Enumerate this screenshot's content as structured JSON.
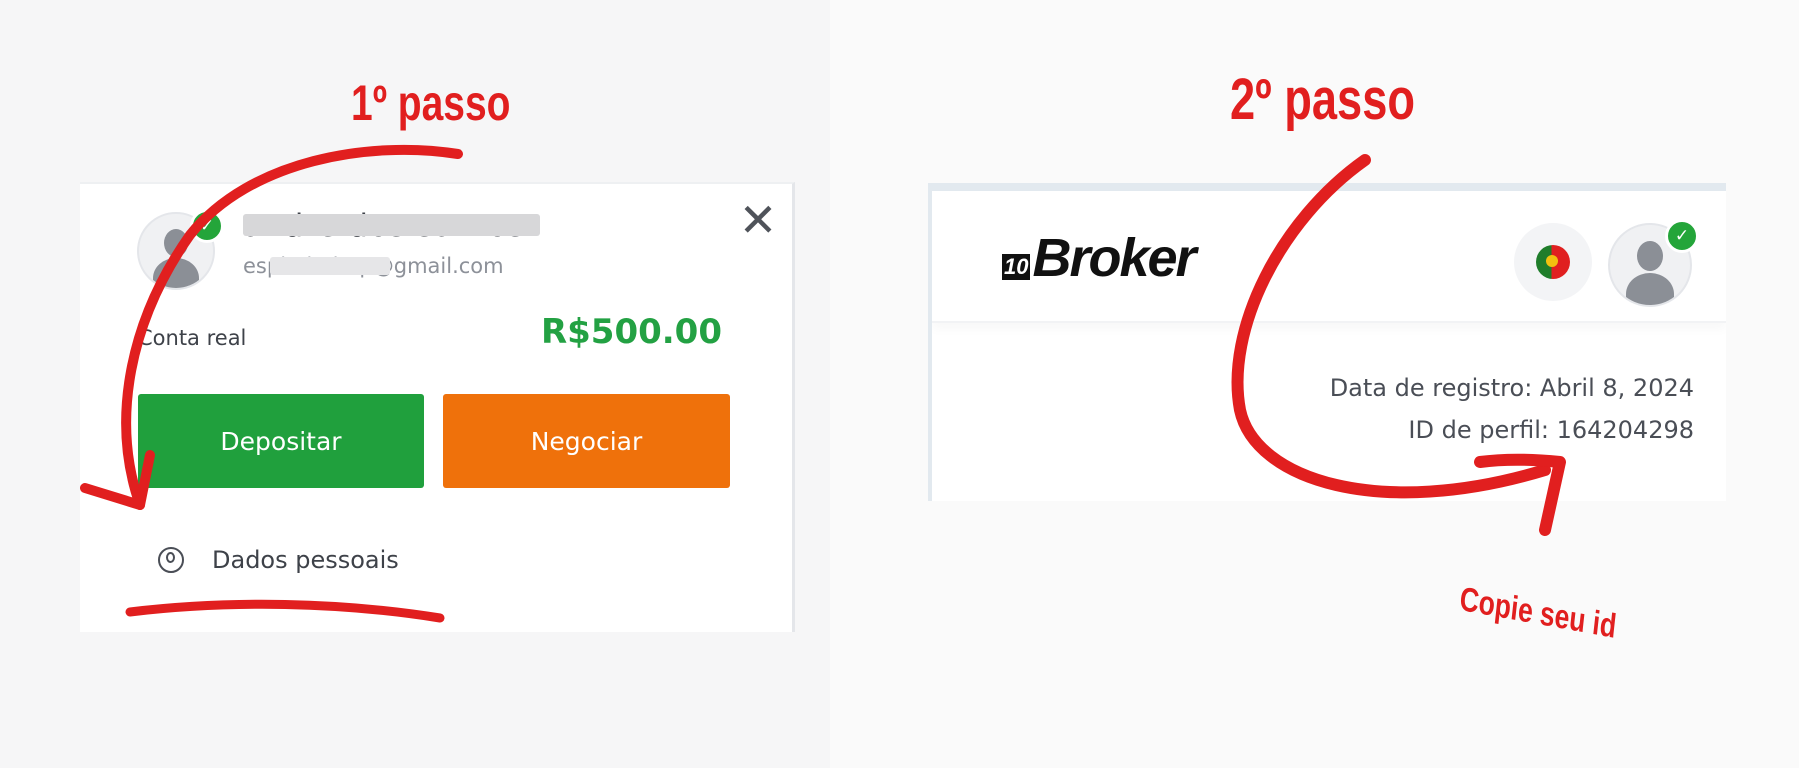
{
  "step1": {
    "label": "1º passo"
  },
  "step2": {
    "label": "2º passo"
  },
  "hint": {
    "label": "Copie seu id"
  },
  "panel1": {
    "user_name": "andre dos santos",
    "user_email": "espiadodrop@gmail.com",
    "account_type": "Conta real",
    "balance": "R$500.00",
    "deposit_button": "Depositar",
    "trade_button": "Negociar",
    "menu_item_personal_data": "Dados pessoais",
    "close_icon": "close-icon",
    "colors": {
      "balance": "#23a143",
      "deposit": "#20a03d",
      "trade": "#ef710b",
      "annotation": "#e11f1f"
    }
  },
  "panel2": {
    "logo_mark": "10",
    "logo_text": "Broker",
    "flag_icon": "portugal-flag-icon",
    "registration_date": "Data de registro: Abril 8, 2024",
    "profile_id": "ID de perfil: 164204298"
  }
}
